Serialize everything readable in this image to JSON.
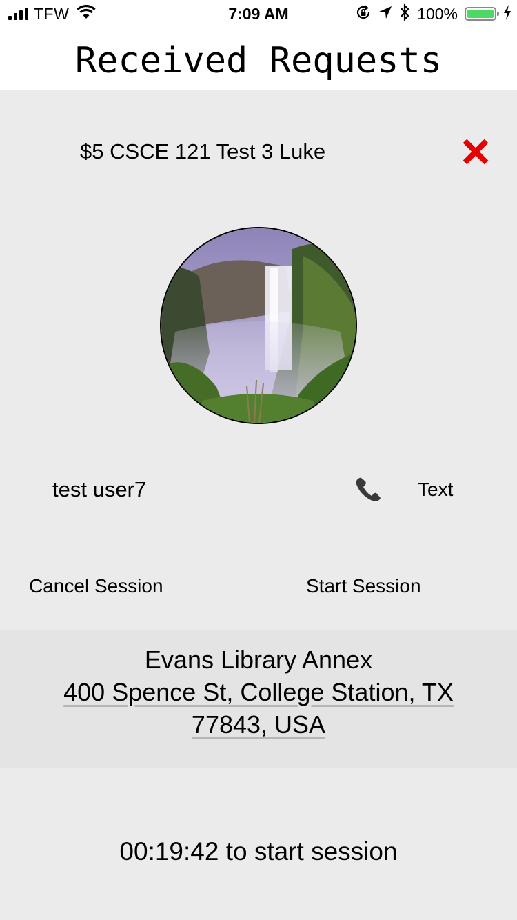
{
  "status_bar": {
    "carrier": "TFW",
    "time": "7:09 AM",
    "battery_percent": "100%",
    "battery_level": 1.0,
    "icons": [
      "signal-icon",
      "wifi-icon",
      "orientation-lock-icon",
      "location-arrow-icon",
      "bluetooth-icon",
      "battery-icon",
      "charging-bolt-icon"
    ]
  },
  "header": {
    "title": "Received Requests"
  },
  "request": {
    "title": "$5 CSCE 121 Test 3 Luke",
    "close_icon": "close-icon",
    "close_color": "#e60000"
  },
  "user": {
    "name": "test user7",
    "avatar_icon": "waterfall-photo",
    "phone_icon": "phone-icon",
    "text_label": "Text"
  },
  "actions": {
    "cancel_label": "Cancel Session",
    "start_label": "Start Session"
  },
  "location": {
    "name": "Evans Library Annex",
    "address": "400 Spence St, College Station, TX 77843, USA"
  },
  "countdown": "00:19:42 to start session",
  "colors": {
    "background": "#ebebeb",
    "panel": "#e4e4e4",
    "battery": "#4cd964"
  }
}
